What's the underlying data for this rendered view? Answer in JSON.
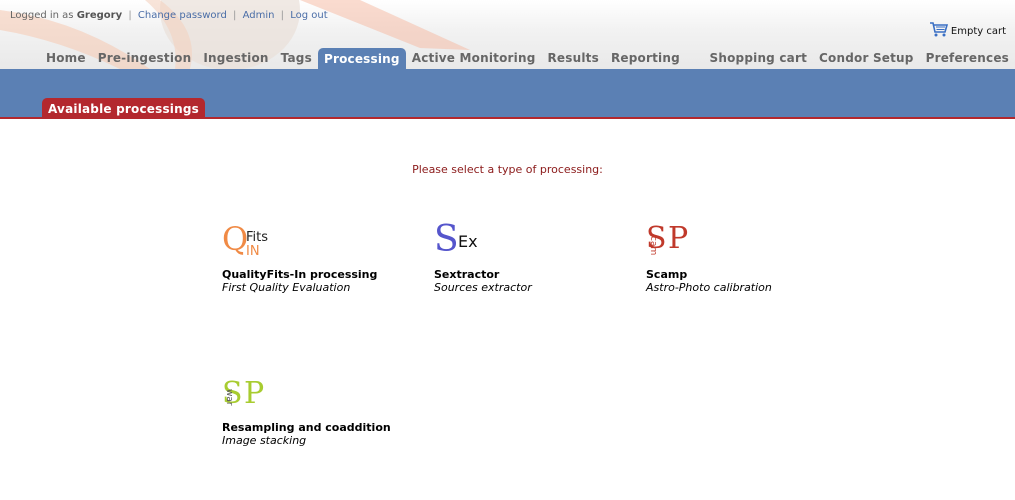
{
  "user": {
    "prefix": "Logged in as",
    "name": "Gregory",
    "links": [
      "Change password",
      "Admin",
      "Log out"
    ]
  },
  "cart": {
    "label": "Empty cart",
    "icon": "cart-icon"
  },
  "nav": {
    "left": [
      "Home",
      "Pre-ingestion",
      "Ingestion",
      "Tags",
      "Processing",
      "Active Monitoring",
      "Results",
      "Reporting"
    ],
    "right": [
      "Shopping cart",
      "Condor Setup",
      "Preferences"
    ],
    "active": "Processing"
  },
  "subnav": {
    "active_tab": "Available processings"
  },
  "main": {
    "prompt": "Please select a type of processing:",
    "processings": [
      {
        "logo_main": "Q",
        "logo_a": "Fits",
        "logo_b": "IN",
        "name": "QualityFits-In processing",
        "desc": "First Quality Evaluation"
      },
      {
        "logo_main": "S",
        "logo_a": "Ex",
        "name": "Sextractor",
        "desc": "Sources extractor"
      },
      {
        "logo_main": "S",
        "logo_a": "P",
        "logo_b": "cam",
        "name": "Scamp",
        "desc": "Astro-Photo calibration"
      },
      {
        "logo_main": "S",
        "logo_a": "P",
        "logo_b": "war",
        "name": "Resampling and coaddition",
        "desc": "Image stacking"
      }
    ]
  },
  "colors": {
    "accent_blue": "#5b80b4",
    "accent_red": "#b3282e",
    "prompt_text": "#8b1a1a",
    "link": "#4a6da7",
    "qfits_logo": "#f08a45",
    "sex_logo": "#5555cc",
    "scamp_logo": "#c0392b",
    "swarp_logo": "#a8cc30"
  }
}
